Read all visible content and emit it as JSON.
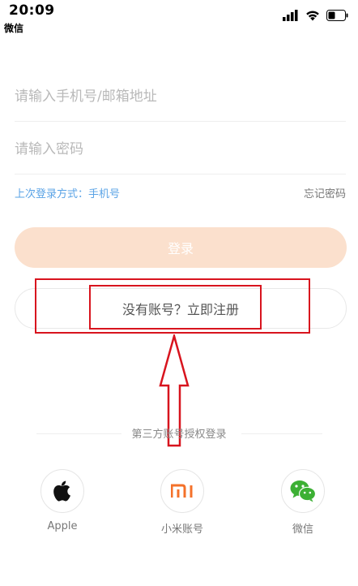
{
  "status_bar": {
    "time": "20:09",
    "app_name": "微信"
  },
  "login_form": {
    "phone_placeholder": "请输入手机号/邮箱地址",
    "password_placeholder": "请输入密码",
    "last_login": "上次登录方式：手机号",
    "forgot_password": "忘记密码",
    "login_button": "登录",
    "register_button": "没有账号？立即注册"
  },
  "third_party": {
    "title": "第三方账号授权登录",
    "providers": [
      {
        "label": "Apple",
        "icon": "apple-icon"
      },
      {
        "label": "小米账号",
        "icon": "mi-icon"
      },
      {
        "label": "微信",
        "icon": "wechat-icon"
      }
    ]
  },
  "colors": {
    "accent_light": "#fbe0cd",
    "link_blue": "#5aa3e6",
    "annotation_red": "#d8141e",
    "mi_orange": "#f4712a",
    "wechat_green": "#3cb034"
  }
}
